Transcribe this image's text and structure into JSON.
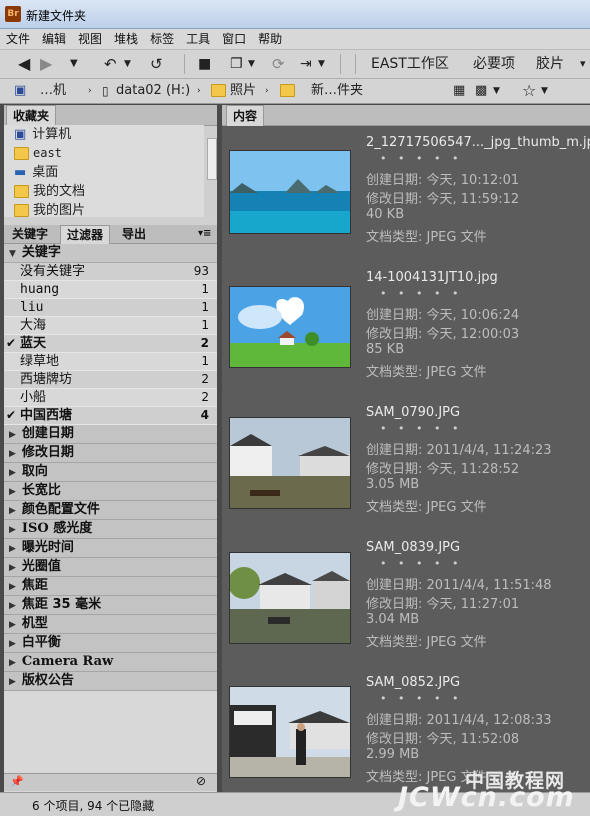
{
  "window": {
    "title": "新建文件夹",
    "app_badge": "Br"
  },
  "menu": [
    "文件",
    "编辑",
    "视图",
    "堆栈",
    "标签",
    "工具",
    "窗口",
    "帮助"
  ],
  "workspace": {
    "items": [
      "EAST工作区",
      "必要项",
      "胶片"
    ],
    "more": "▾"
  },
  "path": {
    "computer": "…机",
    "drive": "data02 (H:)",
    "folder1": "照片",
    "folder2": "新…件夹"
  },
  "left_panel": {
    "favorites_tab": "收藏夹",
    "favorites": [
      "计算机",
      "east",
      "桌面",
      "我的文档",
      "我的图片"
    ],
    "tabs": [
      "关键字",
      "过滤器",
      "导出"
    ],
    "keywords_header": "关键字",
    "keywords": [
      {
        "label": "没有关键字",
        "count": "93",
        "checked": false
      },
      {
        "label": "huang",
        "count": "1",
        "checked": false
      },
      {
        "label": "liu",
        "count": "1",
        "checked": false
      },
      {
        "label": "大海",
        "count": "1",
        "checked": false
      },
      {
        "label": "蓝天",
        "count": "2",
        "checked": true
      },
      {
        "label": "绿草地",
        "count": "1",
        "checked": false
      },
      {
        "label": "西塘牌坊",
        "count": "2",
        "checked": false
      },
      {
        "label": "小船",
        "count": "2",
        "checked": false
      },
      {
        "label": "中国西塘",
        "count": "4",
        "checked": true
      }
    ],
    "categories": [
      "创建日期",
      "修改日期",
      "取向",
      "长宽比",
      "颜色配置文件",
      "ISO 感光度",
      "曝光时间",
      "光圈值",
      "焦距",
      "焦距 35 毫米",
      "机型",
      "白平衡",
      "Camera Raw",
      "版权公告"
    ]
  },
  "content": {
    "tab": "内容",
    "items": [
      {
        "name": "2_12717506547..._jpg_thumb_m.jpg",
        "stars": "• • • • •",
        "created": "创建日期: 今天, 10:12:01",
        "modified": "修改日期: 今天, 11:59:12",
        "size": "40 KB",
        "type": "文档类型: JPEG 文件"
      },
      {
        "name": "14-1004131JT10.jpg",
        "stars": "• • • • •",
        "created": "创建日期: 今天, 10:06:24",
        "modified": "修改日期: 今天, 12:00:03",
        "size": "85 KB",
        "type": "文档类型: JPEG 文件"
      },
      {
        "name": "SAM_0790.JPG",
        "stars": "• • • • •",
        "created": "创建日期: 2011/4/4, 11:24:23",
        "modified": "修改日期: 今天, 11:28:52",
        "size": "3.05 MB",
        "type": "文档类型: JPEG 文件"
      },
      {
        "name": "SAM_0839.JPG",
        "stars": "• • • • •",
        "created": "创建日期: 2011/4/4, 11:51:48",
        "modified": "修改日期: 今天, 11:27:01",
        "size": "3.04 MB",
        "type": "文档类型: JPEG 文件"
      },
      {
        "name": "SAM_0852.JPG",
        "stars": "• • • • •",
        "created": "创建日期: 2011/4/4, 12:08:33",
        "modified": "修改日期: 今天, 11:52:08",
        "size": "2.99 MB",
        "type": "文档类型: JPEG 文件"
      }
    ]
  },
  "status": {
    "text": "6 个项目, 94 个已隐藏"
  },
  "watermark": {
    "line1": "中国教程网",
    "line2": "JCWcn.com"
  }
}
